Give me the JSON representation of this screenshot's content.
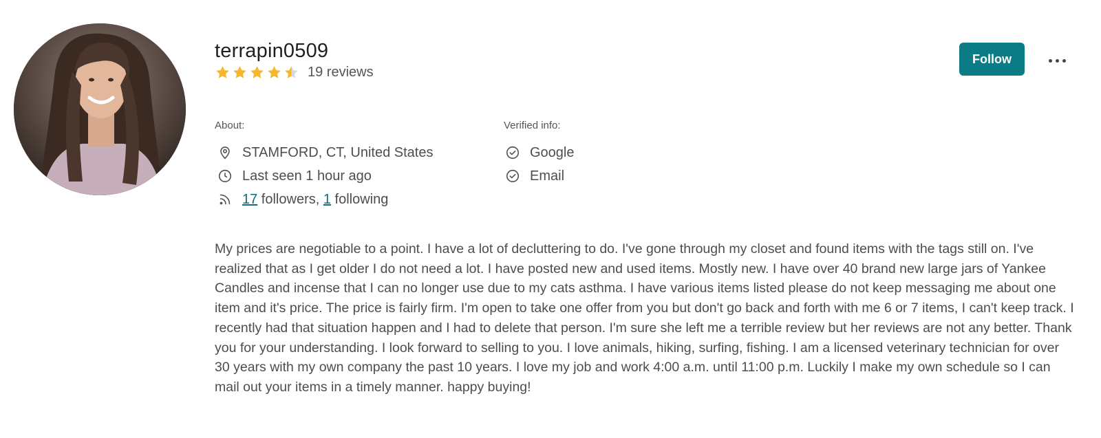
{
  "profile": {
    "username": "terrapin0509",
    "rating": 4.5,
    "rating_max": 5,
    "reviews_label": "19 reviews",
    "avatar_alt": "profile-photo"
  },
  "actions": {
    "follow_label": "Follow",
    "more_icon": "more-horizontal-icon"
  },
  "about": {
    "heading": "About:",
    "location": "STAMFORD, CT, United States",
    "last_seen": "Last seen 1 hour ago",
    "followers_count": "17",
    "followers_text": " followers, ",
    "following_count": "1",
    "following_text": " following"
  },
  "verified": {
    "heading": "Verified info:",
    "items": [
      "Google",
      "Email"
    ]
  },
  "bio": "My prices are negotiable to a point. I have a lot of decluttering to do. I've gone through my closet and found items with the tags still on. I've realized that as I get older I do not need a lot. I have posted new and used items. Mostly new. I have over 40 brand new large jars of Yankee Candles and incense that I can no longer use due to my cats asthma. I have various items listed please do not keep messaging me about one item and it's price. The price is fairly firm. I'm open to take one offer from you but don't go back and forth with me 6 or 7 items, I can't keep track. I recently had that situation happen and I had to delete that person. I'm sure she left me a terrible review but her reviews are not any better. Thank you for your understanding. I look forward to selling to you. I love animals, hiking, surfing, fishing. I am a licensed veterinary technician for over 30 years with my own company the past 10 years. I love my job and work 4:00 a.m. until 11:00 p.m. Luckily I make my own schedule so I can mail out your items in a timely manner. happy buying!",
  "colors": {
    "accent": "#0b7b85",
    "star": "#f5b731",
    "star_empty": "#d9d9d9",
    "text": "#4d4d4d"
  }
}
